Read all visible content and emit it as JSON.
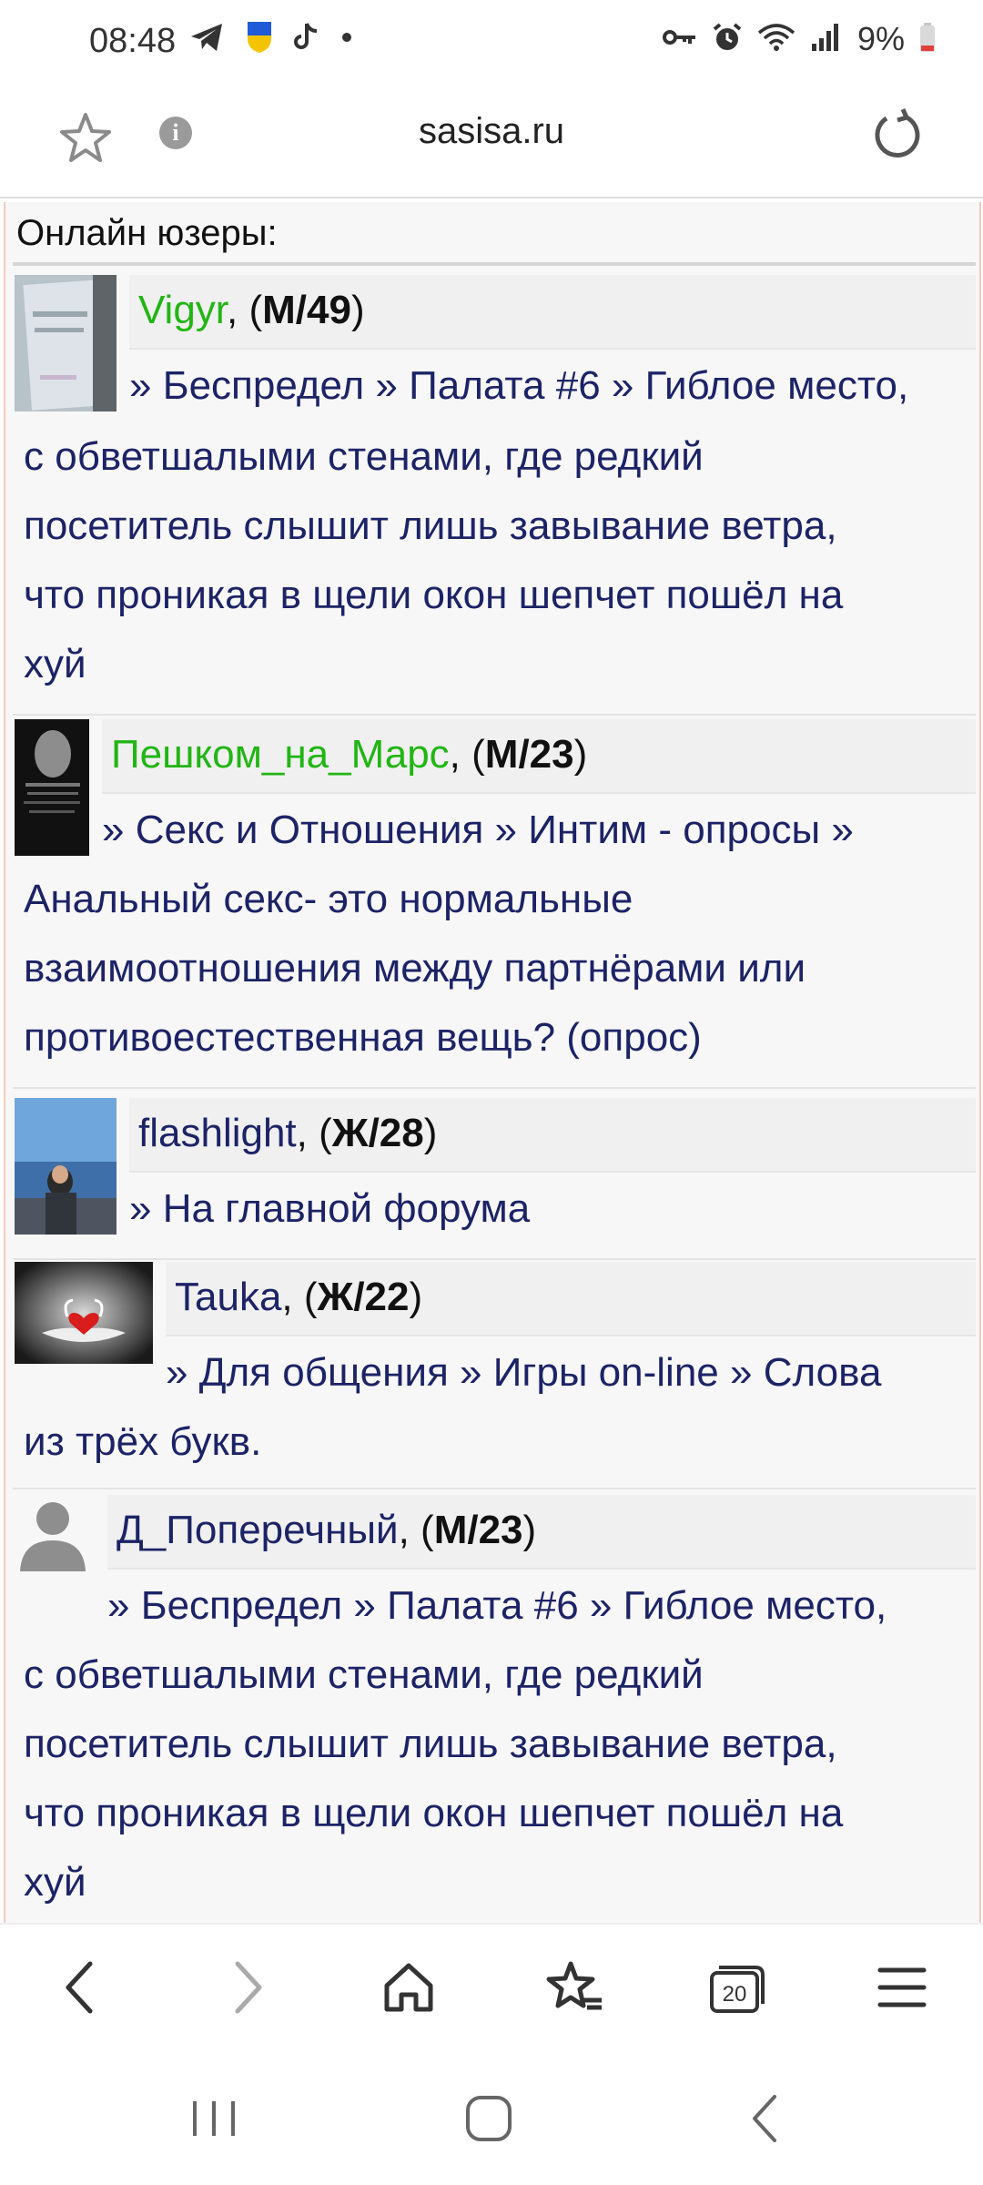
{
  "status_bar": {
    "time": "08:48",
    "battery": "9%",
    "icons_left": [
      "telegram-icon",
      "ukraine-shield-icon",
      "tiktok-icon",
      "dot-icon"
    ],
    "icons_right": [
      "key-icon",
      "alarm-icon",
      "wifi-icon",
      "signal-icon",
      "battery-icon"
    ]
  },
  "browser": {
    "url": "sasisa.ru",
    "icons": [
      "star-icon",
      "info-icon",
      "reload-icon"
    ]
  },
  "online": {
    "title": "Онлайн юзеры:",
    "users": [
      {
        "name": "Vigyr",
        "name_color": "#22b514",
        "gender": "М",
        "age": "49",
        "location": "» Беспредел » Палата #6 » Гиблое место,",
        "location_rest": [
          "с обветшалыми стенами, где редкий",
          "посетитель слышит лишь завывание ветра,",
          "что проникая в щели окон шепчет пошёл на",
          "хуй"
        ]
      },
      {
        "name": "Пешком_на_Марс",
        "name_color": "#22b514",
        "gender": "М",
        "age": "23",
        "location": "» Секс и Отношения » Интим - опросы »",
        "location_rest": [
          "Анальный секс- это нормальные",
          "взаимоотношения между партнёрами или",
          "противоестественная вещь? (опрос)"
        ]
      },
      {
        "name": "flashlight",
        "name_color": "#1c2366",
        "gender": "Ж",
        "age": "28",
        "location": "» На главной форума",
        "location_rest": []
      },
      {
        "name": "Tauka",
        "name_color": "#1c2366",
        "gender": "Ж",
        "age": "22",
        "location": "» Для общения » Игры on-line » Слова",
        "location_rest": [
          "из трёх букв."
        ]
      },
      {
        "name": "Д_Поперечный",
        "name_color": "#1c2366",
        "gender": "М",
        "age": "23",
        "location": "» Беспредел » Палата #6 » Гиблое место,",
        "location_rest": [
          "с обветшалыми стенами, где редкий",
          "посетитель слышит лишь завывание ветра,",
          "что проникая в щели окон шепчет пошёл на",
          "хуй"
        ]
      }
    ]
  },
  "bottom_bar": {
    "icons": [
      "back-icon",
      "forward-icon",
      "home-icon",
      "bookmarks-icon",
      "tabs-icon",
      "menu-icon"
    ],
    "tabs_count": "20"
  },
  "system_nav": {
    "icons": [
      "recents-icon",
      "home-nav-icon",
      "back-nav-icon"
    ]
  }
}
